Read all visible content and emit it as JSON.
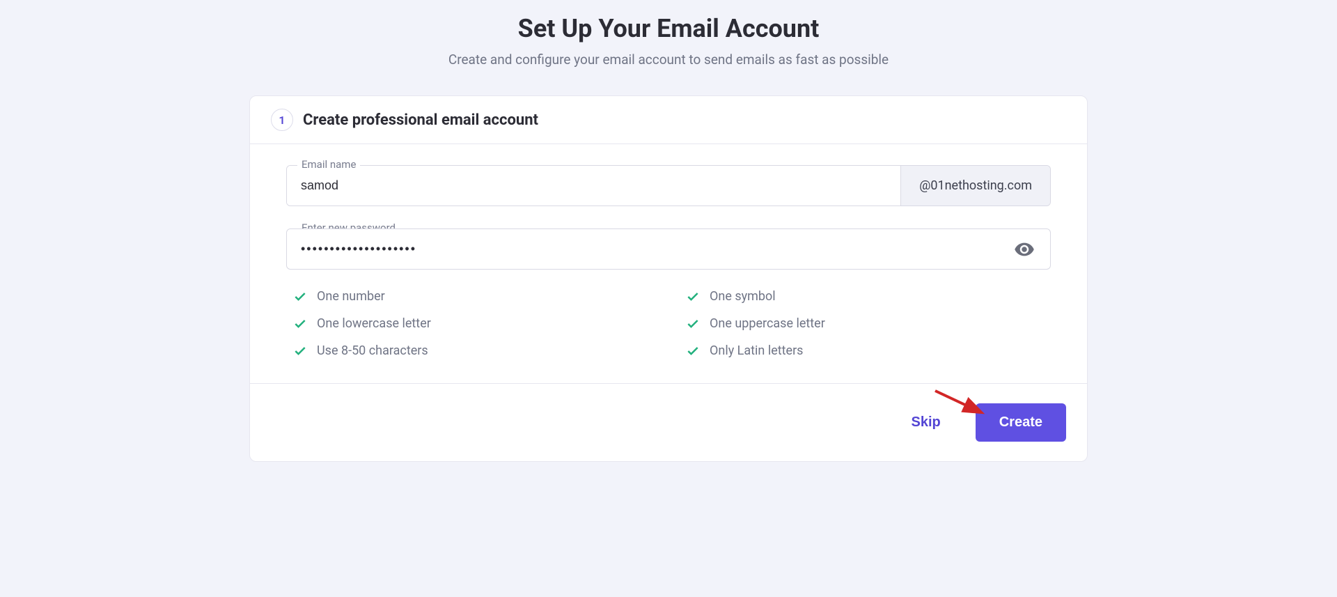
{
  "header": {
    "title": "Set Up Your Email Account",
    "subtitle": "Create and configure your email account to send emails as fast as possible"
  },
  "step": {
    "number": "1",
    "heading": "Create professional email account"
  },
  "email": {
    "label": "Email name",
    "value": "samod",
    "domain": "@01nethosting.com"
  },
  "password": {
    "label": "Enter new password",
    "value": "••••••••••••••••••••"
  },
  "requirements": {
    "r1": "One number",
    "r2": "One symbol",
    "r3": "One lowercase letter",
    "r4": "One uppercase letter",
    "r5": "Use 8-50 characters",
    "r6": "Only Latin letters"
  },
  "actions": {
    "skip": "Skip",
    "create": "Create"
  }
}
